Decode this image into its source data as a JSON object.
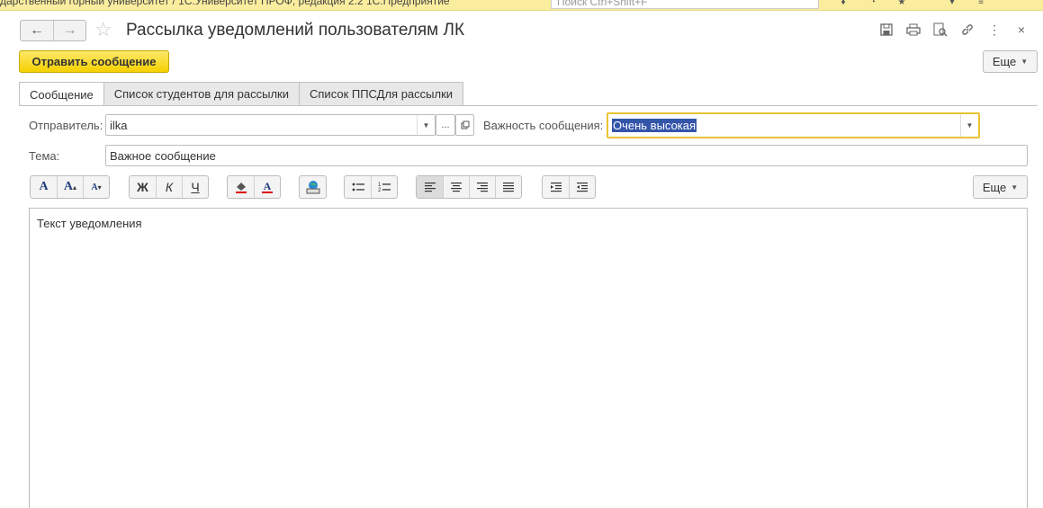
{
  "appbar": {
    "title": "дарственный горный университет / 1С:Университет ПРОФ, редакция 2.2 1С:Предприятие",
    "search_placeholder": "Поиск Ctrl+Shift+F"
  },
  "header": {
    "title": "Рассылка уведомлений пользователям ЛК",
    "back_glyph": "←",
    "forward_glyph": "→",
    "star_glyph": "☆",
    "icons": [
      "save-icon",
      "print-icon",
      "preview-icon",
      "link-icon",
      "more-vertical-icon",
      "close-icon"
    ],
    "close_glyph": "×",
    "more_glyph": "⋮"
  },
  "commandbar": {
    "send_label": "Отравить сообщение",
    "more_label": "Еще"
  },
  "tabs": [
    {
      "label": "Сообщение",
      "active": true
    },
    {
      "label": "Список студентов для рассылки",
      "active": false
    },
    {
      "label": "Список ППСДля рассылки",
      "active": false
    }
  ],
  "form": {
    "sender_label": "Отправитель:",
    "sender_value": "ilka",
    "sender_more": "...",
    "importance_label": "Важность сообщения:",
    "importance_value": "Очень высокая",
    "subject_label": "Тема:",
    "subject_value": "Важное сообщение"
  },
  "toolbar": {
    "more_label": "Еще",
    "font_glyph": "A",
    "bold_glyph": "Ж",
    "italic_glyph": "К",
    "underline_glyph": "Ч"
  },
  "editor": {
    "text": "Текст уведомления"
  },
  "colors": {
    "accent_yellow": "#f5d100",
    "selection": "#3355aa",
    "focus_border": "#e9c434"
  }
}
